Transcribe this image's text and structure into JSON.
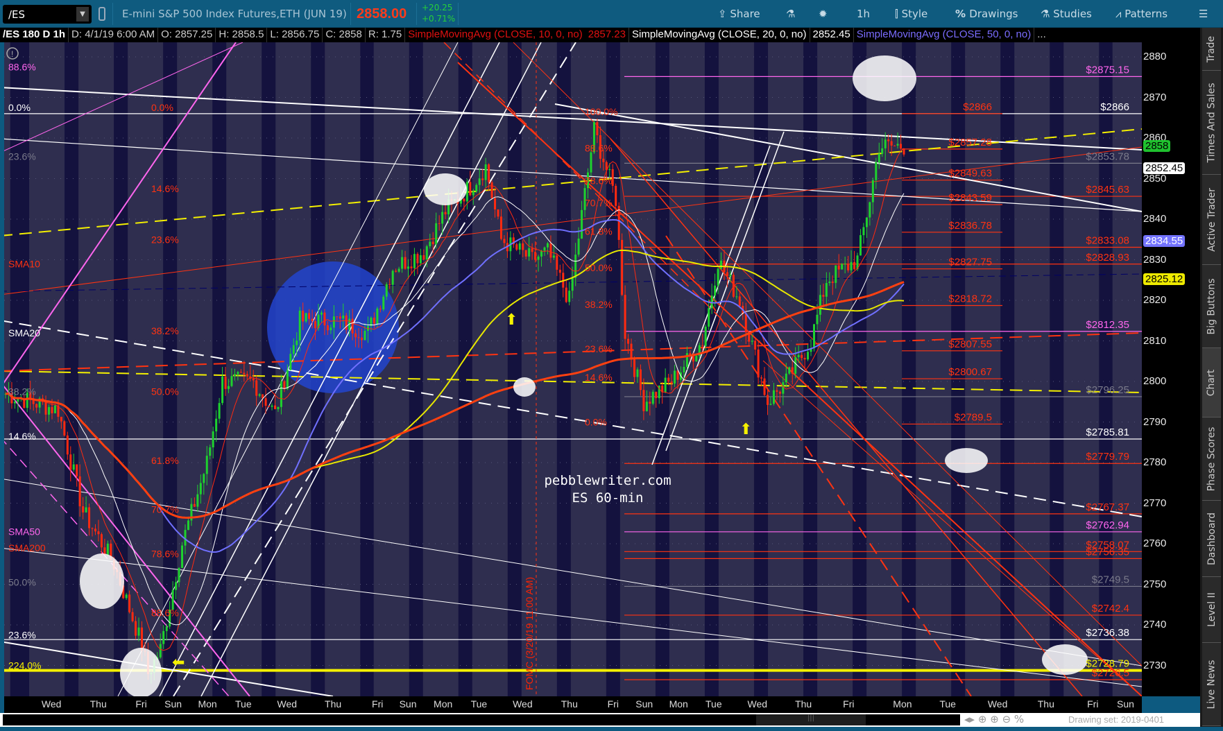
{
  "toolbar": {
    "symbol": "/ES",
    "description": "E-mini S&P 500 Index Futures,ETH (JUN 19)",
    "last_price": "2858.00",
    "change": "+20.25",
    "change_pct": "+0.71%",
    "share": "Share",
    "timeframe": "1h",
    "style": "Style",
    "drawings": "Drawings",
    "studies": "Studies",
    "patterns": "Patterns"
  },
  "infobar": {
    "title": "/ES 180 D 1h",
    "date": "D: 4/1/19 6:00 AM",
    "open": "O: 2857.25",
    "high": "H: 2858.5",
    "low": "L: 2856.75",
    "close": "C: 2858",
    "range": "R: 1.75",
    "sma10_label": "SimpleMovingAvg (CLOSE, 10, 0, no)",
    "sma10_value": "2857.23",
    "sma20_label": "SimpleMovingAvg (CLOSE, 20, 0, no)",
    "sma20_value": "2852.45",
    "sma50_label": "SimpleMovingAvg (CLOSE, 50, 0, no)",
    "more": "..."
  },
  "colors": {
    "red": "#ff3311",
    "magenta": "#ff66ee",
    "white": "#ffffff",
    "gray": "#7a7a8a",
    "yellow": "#f4f000",
    "blue": "#6f6fff",
    "green": "#19c32a"
  },
  "price_axis": {
    "ticks": [
      2880,
      2870,
      2860,
      2850,
      2840,
      2830,
      2820,
      2810,
      2800,
      2790,
      2780,
      2770,
      2760,
      2750,
      2740,
      2730
    ],
    "min": 2722,
    "max": 2886
  },
  "price_badges": [
    {
      "value": "2858",
      "color": "#1fc12e"
    },
    {
      "value": "2852.45",
      "color": "#ffffff"
    },
    {
      "value": "2834.55",
      "color": "#7373ff"
    },
    {
      "value": "2825.12",
      "color": "#eeea00"
    }
  ],
  "price_levels": [
    {
      "price": 2875.15,
      "text": "$2875.15",
      "color": "magenta",
      "side": "right"
    },
    {
      "price": 2866,
      "text": "$2866",
      "color": "white",
      "side": "right"
    },
    {
      "price": 2866,
      "text": "$2866",
      "color": "red",
      "side": "mid"
    },
    {
      "price": 2857.28,
      "text": "$2857.28",
      "color": "red",
      "side": "mid"
    },
    {
      "price": 2853.78,
      "text": "$2853.78",
      "color": "gray",
      "side": "right"
    },
    {
      "price": 2849.63,
      "text": "$2849.63",
      "color": "red",
      "side": "mid"
    },
    {
      "price": 2845.63,
      "text": "$2845.63",
      "color": "red",
      "side": "right"
    },
    {
      "price": 2843.59,
      "text": "$2843.59",
      "color": "red",
      "side": "mid"
    },
    {
      "price": 2836.78,
      "text": "$2836.78",
      "color": "red",
      "side": "mid"
    },
    {
      "price": 2833.08,
      "text": "$2833.08",
      "color": "red",
      "side": "right"
    },
    {
      "price": 2828.93,
      "text": "$2828.93",
      "color": "red",
      "side": "right"
    },
    {
      "price": 2827.75,
      "text": "$2827.75",
      "color": "red",
      "side": "mid"
    },
    {
      "price": 2818.72,
      "text": "$2818.72",
      "color": "red",
      "side": "mid"
    },
    {
      "price": 2812.35,
      "text": "$2812.35",
      "color": "magenta",
      "side": "right"
    },
    {
      "price": 2807.55,
      "text": "$2807.55",
      "color": "red",
      "side": "mid"
    },
    {
      "price": 2800.67,
      "text": "$2800.67",
      "color": "red",
      "side": "mid"
    },
    {
      "price": 2796.25,
      "text": "$2796.25",
      "color": "gray",
      "side": "right"
    },
    {
      "price": 2789.5,
      "text": "$2789.5",
      "color": "red",
      "side": "mid"
    },
    {
      "price": 2785.81,
      "text": "$2785.81",
      "color": "white",
      "side": "right"
    },
    {
      "price": 2779.79,
      "text": "$2779.79",
      "color": "red",
      "side": "right"
    },
    {
      "price": 2767.37,
      "text": "$2767.37",
      "color": "red",
      "side": "right"
    },
    {
      "price": 2762.94,
      "text": "$2762.94",
      "color": "magenta",
      "side": "right"
    },
    {
      "price": 2758.07,
      "text": "$2758.07",
      "color": "red",
      "side": "right"
    },
    {
      "price": 2756.35,
      "text": "$2756.35",
      "color": "red",
      "side": "right"
    },
    {
      "price": 2749.5,
      "text": "$2749.5",
      "color": "gray",
      "side": "right"
    },
    {
      "price": 2742.4,
      "text": "$2742.4",
      "color": "red",
      "side": "right"
    },
    {
      "price": 2736.38,
      "text": "$2736.38",
      "color": "white",
      "side": "right"
    },
    {
      "price": 2728.79,
      "text": "$2728.79",
      "color": "yellow",
      "side": "right"
    },
    {
      "price": 2726.5,
      "text": "$2726.5",
      "color": "red",
      "side": "right"
    }
  ],
  "fib_labels": [
    {
      "price": 2877.5,
      "text": "88.6%",
      "color": "magenta",
      "side": "left"
    },
    {
      "price": 2867.5,
      "text": "0.0%",
      "color": "white",
      "side": "left"
    },
    {
      "price": 2867.5,
      "text": "0.0%",
      "color": "red",
      "side": "left2"
    },
    {
      "price": 2855.5,
      "text": "23.6%",
      "color": "gray",
      "side": "left"
    },
    {
      "price": 2847.5,
      "text": "14.6%",
      "color": "red",
      "side": "left2"
    },
    {
      "price": 2835,
      "text": "23.6%",
      "color": "red",
      "side": "left2"
    },
    {
      "price": 2829,
      "text": "SMA10",
      "color": "red",
      "side": "left"
    },
    {
      "price": 2812.5,
      "text": "38.2%",
      "color": "red",
      "side": "left2"
    },
    {
      "price": 2812,
      "text": "SMA20",
      "color": "white",
      "side": "left"
    },
    {
      "price": 2797.5,
      "text": "50.0%",
      "color": "red",
      "side": "left2"
    },
    {
      "price": 2797.5,
      "text": "38.2%",
      "color": "gray",
      "side": "left"
    },
    {
      "price": 2786.5,
      "text": "14.6%",
      "color": "white",
      "side": "left"
    },
    {
      "price": 2780.5,
      "text": "61.8%",
      "color": "red",
      "side": "left2"
    },
    {
      "price": 2768.5,
      "text": "70.7%",
      "color": "red",
      "side": "left2"
    },
    {
      "price": 2763,
      "text": "SMA50",
      "color": "magenta",
      "side": "left"
    },
    {
      "price": 2759,
      "text": "SMA200",
      "color": "red",
      "side": "left"
    },
    {
      "price": 2757.5,
      "text": "78.6%",
      "color": "red",
      "side": "left2"
    },
    {
      "price": 2750.5,
      "text": "50.0%",
      "color": "gray",
      "side": "left"
    },
    {
      "price": 2743,
      "text": "88.6%",
      "color": "red",
      "side": "left2"
    },
    {
      "price": 2737.5,
      "text": "23.6%",
      "color": "white",
      "side": "left"
    },
    {
      "price": 2730,
      "text": "224.0%",
      "color": "yellow",
      "side": "left"
    },
    {
      "price": 2866.5,
      "text": "100.0%",
      "color": "red",
      "side": "mid2"
    },
    {
      "price": 2857.5,
      "text": "88.6%",
      "color": "red",
      "side": "mid2"
    },
    {
      "price": 2849.5,
      "text": "78.6%",
      "color": "red",
      "side": "mid2"
    },
    {
      "price": 2844,
      "text": "70.7%",
      "color": "red",
      "side": "mid2"
    },
    {
      "price": 2837,
      "text": "61.8%",
      "color": "red",
      "side": "mid2"
    },
    {
      "price": 2828,
      "text": "50.0%",
      "color": "red",
      "side": "mid2"
    },
    {
      "price": 2819,
      "text": "38.2%",
      "color": "red",
      "side": "mid2"
    },
    {
      "price": 2808,
      "text": "23.6%",
      "color": "red",
      "side": "mid2"
    },
    {
      "price": 2801,
      "text": "14.6%",
      "color": "red",
      "side": "mid2"
    },
    {
      "price": 2790,
      "text": "0.0%",
      "color": "red",
      "side": "mid2"
    }
  ],
  "price_path": [
    [
      0,
      2797
    ],
    [
      17,
      2793
    ],
    [
      25,
      2768
    ],
    [
      35,
      2755
    ],
    [
      44,
      2735
    ],
    [
      46,
      2728
    ],
    [
      50,
      2734
    ],
    [
      57,
      2760
    ],
    [
      65,
      2780
    ],
    [
      70,
      2800
    ],
    [
      80,
      2800
    ],
    [
      87,
      2792
    ],
    [
      95,
      2815
    ],
    [
      107,
      2815
    ],
    [
      117,
      2812
    ],
    [
      125,
      2828
    ],
    [
      135,
      2832
    ],
    [
      142,
      2842
    ],
    [
      150,
      2848
    ],
    [
      155,
      2853
    ],
    [
      160,
      2835
    ],
    [
      170,
      2830
    ],
    [
      175,
      2832
    ],
    [
      182,
      2820
    ],
    [
      190,
      2862
    ],
    [
      197,
      2845
    ],
    [
      200,
      2812
    ],
    [
      206,
      2795
    ],
    [
      215,
      2800
    ],
    [
      225,
      2810
    ],
    [
      230,
      2830
    ],
    [
      237,
      2820
    ],
    [
      246,
      2795
    ],
    [
      252,
      2800
    ],
    [
      260,
      2810
    ],
    [
      265,
      2825
    ],
    [
      275,
      2830
    ],
    [
      279,
      2845
    ],
    [
      282,
      2858
    ],
    [
      290,
      2858
    ]
  ],
  "annotations": {
    "watermark_line1": "pebblewriter.com",
    "watermark_line2": "ES 60-min",
    "fomc": "FOMC (3/20/19 11:00 AM)"
  },
  "time_axis": [
    "Wed",
    "Thu",
    "Fri",
    "Sun",
    "Mon",
    "Tue",
    "Wed",
    "Thu",
    "Fri",
    "Sun",
    "Mon",
    "Tue",
    "Wed",
    "Thu",
    "Fri",
    "Sun",
    "Mon",
    "Tue",
    "Wed",
    "Thu",
    "Fri",
    "Mon",
    "Tue",
    "Wed",
    "Thu",
    "Fri",
    "Sun"
  ],
  "sidebar_tabs": [
    "Trade",
    "Times And Sales",
    "Active Trader",
    "Big Buttons",
    "Chart",
    "Phase Scores",
    "Dashboard",
    "Level II",
    "Live News"
  ],
  "bottom": {
    "drawing_set": "Drawing set: 2019-0401"
  }
}
